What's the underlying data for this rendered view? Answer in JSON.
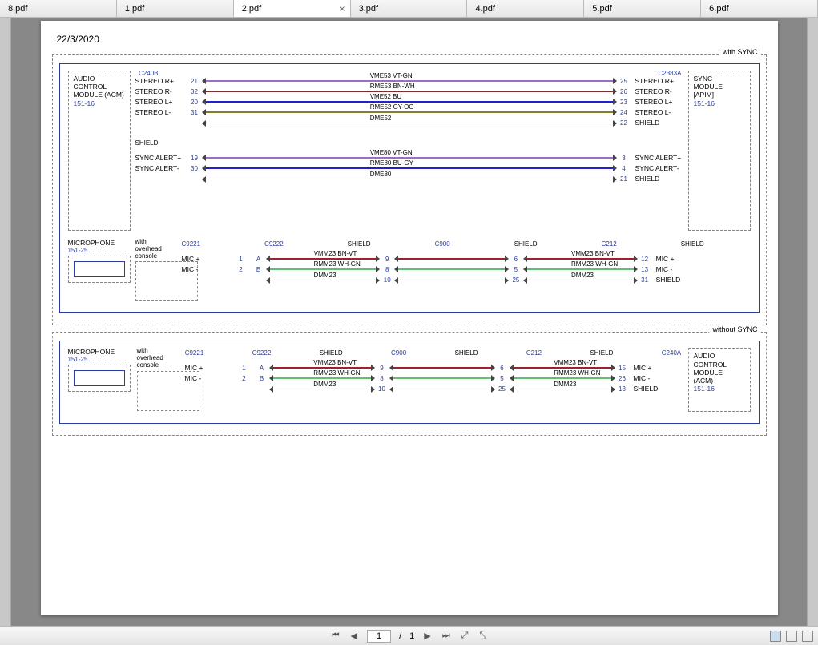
{
  "tabs": [
    "8.pdf",
    "1.pdf",
    "2.pdf",
    "3.pdf",
    "4.pdf",
    "5.pdf",
    "6.pdf"
  ],
  "active_tab_index": 2,
  "date": "22/3/2020",
  "block1": {
    "badge": "with SYNC",
    "acm": {
      "title": "AUDIO\nCONTROL\nMODULE (ACM)",
      "ref": "151-16",
      "conn": "C240B"
    },
    "sync": {
      "title": "SYNC\nMODULE\n[APIM]",
      "ref": "151-16",
      "conn": "C2383A"
    },
    "shield_label": "SHIELD",
    "wires_top": [
      {
        "sigL": "STEREO R+",
        "pinL": "21",
        "name": "VME53",
        "code": "VT-GN",
        "color": "#a06cc0",
        "pinR": "25",
        "sigR": "STEREO R+"
      },
      {
        "sigL": "STEREO R-",
        "pinL": "32",
        "name": "RME53",
        "code": "BN-WH",
        "color": "#7a3030",
        "pinR": "26",
        "sigR": "STEREO R-"
      },
      {
        "sigL": "STEREO L+",
        "pinL": "20",
        "name": "VME52",
        "code": "BU",
        "color": "#2020d0",
        "pinR": "23",
        "sigR": "STEREO L+"
      },
      {
        "sigL": "STEREO L-",
        "pinL": "31",
        "name": "RME52",
        "code": "GY-OG",
        "color": "#8a7a30",
        "pinR": "24",
        "sigR": "STEREO L-"
      },
      {
        "sigL": "",
        "pinL": "",
        "name": "DME52",
        "code": "",
        "color": "#000",
        "thin": true,
        "pinR": "22",
        "sigR": "SHIELD"
      }
    ],
    "wires_alert": [
      {
        "sigL": "SYNC ALERT+",
        "pinL": "19",
        "name": "VME80",
        "code": "VT-GN",
        "color": "#a06cc0",
        "pinR": "3",
        "sigR": "SYNC ALERT+"
      },
      {
        "sigL": "SYNC ALERT-",
        "pinL": "30",
        "name": "RME80",
        "code": "BU-GY",
        "color": "#2020d0",
        "pinR": "4",
        "sigR": "SYNC ALERT-"
      },
      {
        "sigL": "",
        "pinL": "",
        "name": "DME80",
        "code": "",
        "color": "#000",
        "thin": true,
        "pinR": "21",
        "sigR": "SHIELD"
      }
    ],
    "mic": {
      "title": "MICROPHONE",
      "ref": "151-25",
      "console": "with\noverhead\nconsole",
      "c9221": "C9221",
      "c9222": "C9222",
      "c900": "C900",
      "c212": "C212",
      "wires": [
        {
          "sigL": "MIC +",
          "pinL": "1",
          "pinA": "A",
          "name": "VMM23",
          "code": "BN-VT",
          "color": "#a02030",
          "midL": "9",
          "midR": "6",
          "pinR": "12",
          "sigR": "MIC +"
        },
        {
          "sigL": "MIC -",
          "pinL": "2",
          "pinA": "B",
          "name": "RMM23",
          "code": "WH-GN",
          "color": "#60c070",
          "midL": "8",
          "midR": "5",
          "pinR": "13",
          "sigR": "MIC -"
        },
        {
          "sigL": "",
          "pinL": "",
          "pinA": "",
          "name": "",
          "code": "DMM23",
          "color": "#000",
          "thin": true,
          "midL": "10",
          "midR": "25",
          "pinR": "31",
          "sigR": "SHIELD"
        }
      ]
    }
  },
  "block2": {
    "badge": "without SYNC",
    "mic": {
      "title": "MICROPHONE",
      "ref": "151-25"
    },
    "console": "with\noverhead\nconsole",
    "acm": {
      "title": "AUDIO\nCONTROL\nMODULE\n(ACM)",
      "ref": "151-16",
      "conn": "C240A"
    },
    "c9221": "C9221",
    "c9222": "C9222",
    "c900": "C900",
    "c212": "C212",
    "wires": [
      {
        "sigL": "MIC +",
        "pinL": "1",
        "pinA": "A",
        "name": "VMM23",
        "code": "BN-VT",
        "color": "#a02030",
        "midL": "9",
        "midR": "6",
        "pinR": "15",
        "sigR": "MIC +"
      },
      {
        "sigL": "MIC -",
        "pinL": "2",
        "pinA": "B",
        "name": "RMM23",
        "code": "WH-GN",
        "color": "#60c070",
        "midL": "8",
        "midR": "5",
        "pinR": "26",
        "sigR": "MIC -"
      },
      {
        "sigL": "",
        "pinL": "",
        "pinA": "",
        "name": "DMM23",
        "code": "",
        "color": "#000",
        "thin": true,
        "midL": "10",
        "midR": "25",
        "pinR": "13",
        "sigR": "SHIELD"
      }
    ],
    "shield_label": "SHIELD"
  },
  "toolbar": {
    "page_current": "1",
    "page_sep": "/",
    "page_total": "1"
  }
}
